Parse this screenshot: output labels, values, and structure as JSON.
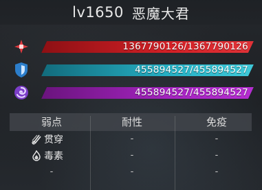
{
  "header": {
    "level": "lv1650",
    "name": "恶魔大君"
  },
  "stats": [
    {
      "icon": "health-cross-icon",
      "text": "1367790126/1367790126",
      "fraction": 1.0,
      "color": "#d8262b"
    },
    {
      "icon": "shield-icon",
      "text": "455894527/455894527",
      "fraction": 1.0,
      "color": "#29b6c9"
    },
    {
      "icon": "spiral-barrier-icon",
      "text": "455894527/455894527",
      "fraction": 1.0,
      "color": "#a428c4"
    }
  ],
  "resistances": {
    "headers": [
      "弱点",
      "耐性",
      "免疫"
    ],
    "weak_items": [
      {
        "icon": "pierce-claw-icon",
        "label": "贯穿"
      },
      {
        "icon": "poison-flame-icon",
        "label": "毒素"
      },
      {
        "icon": "",
        "label": "-"
      }
    ],
    "resist_col": [
      "-",
      "-",
      "-"
    ],
    "immune_col": [
      "-",
      "-",
      "-"
    ]
  }
}
